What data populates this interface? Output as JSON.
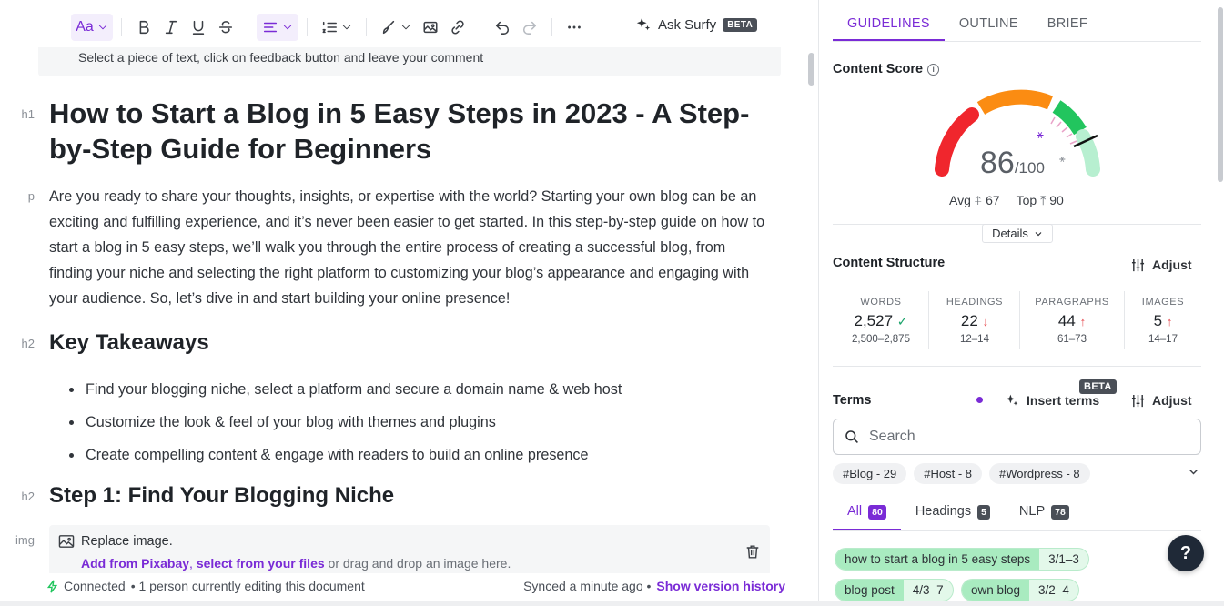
{
  "toolbar": {
    "font_label": "Aa",
    "ask_label": "Ask Surfy",
    "ask_badge": "BETA"
  },
  "hint": "Select a piece of text, click on feedback button and leave your comment",
  "doc": {
    "h1_tag": "h1",
    "title": "How to Start a Blog in 5 Easy Steps in 2023 - A Step-by-Step Guide for Beginners",
    "p_tag": "p",
    "intro": "Are you ready to share your thoughts, insights, or expertise with the world? Starting your own blog can be an exciting and fulfilling experience, and it’s never been easier to get started. In this step-by-step guide on how to start a blog in 5 easy steps, we’ll walk you through the entire process of creating a successful blog, from finding your niche and selecting the right platform to customizing your blog’s appearance and engaging with your audience. So, let’s dive in and start building your online presence!",
    "h2_tag": "h2",
    "takeaways_heading": "Key Takeaways",
    "takeaways": [
      "Find your blogging niche, select a platform and secure a domain name & web host",
      "Customize the look & feel of your blog with themes and plugins",
      "Create compelling content & engage with readers to build an online presence"
    ],
    "step1_heading": "Step 1: Find Your Blogging Niche",
    "img_tag": "img",
    "replace_label": "Replace image.",
    "pixabay_link": "Add from Pixabay",
    "comma": ",",
    "files_link": "select from your files",
    "drag_text": "or drag and drop an image here."
  },
  "status": {
    "connected": "Connected",
    "editing": "• 1 person currently editing this document",
    "synced": "Synced a minute ago •",
    "version_history": "Show version history"
  },
  "panel": {
    "tabs": [
      "GUIDELINES",
      "OUTLINE",
      "BRIEF"
    ],
    "content_score_title": "Content Score",
    "score": "86",
    "score_max": "/100",
    "score_fraction": 0.86,
    "avg_label": "Avg",
    "avg_value": "67",
    "top_label": "Top",
    "top_value": "90",
    "details_label": "Details",
    "structure_title": "Content Structure",
    "adjust_label": "Adjust",
    "stats": [
      {
        "label": "WORDS",
        "value": "2,527",
        "status": "ok",
        "range": "2,500–2,875"
      },
      {
        "label": "HEADINGS",
        "value": "22",
        "status": "down",
        "range": "12–14"
      },
      {
        "label": "PARAGRAPHS",
        "value": "44",
        "status": "up",
        "range": "61–73"
      },
      {
        "label": "IMAGES",
        "value": "5",
        "status": "up",
        "range": "14–17"
      }
    ],
    "terms_title": "Terms",
    "insert_terms": "Insert terms",
    "insert_badge": "BETA",
    "search_placeholder": "Search",
    "chips": [
      "#Blog - 29",
      "#Host - 8",
      "#Wordpress - 8"
    ],
    "subtabs": [
      {
        "label": "All",
        "count": "80"
      },
      {
        "label": "Headings",
        "count": "5"
      },
      {
        "label": "NLP",
        "count": "78"
      }
    ],
    "terms": [
      {
        "term": "how to start a blog in 5 easy steps",
        "count": "3/1–3"
      },
      {
        "term": "blog post",
        "count": "4/3–7"
      },
      {
        "term": "own blog",
        "count": "3/2–4"
      }
    ],
    "help_label": "?"
  },
  "colors": {
    "accent": "#7a2bd6",
    "gauge_red": "#f0262d",
    "gauge_orange": "#fb8c12",
    "gauge_green": "#22c55e",
    "gauge_light_green": "#b7efd0"
  }
}
